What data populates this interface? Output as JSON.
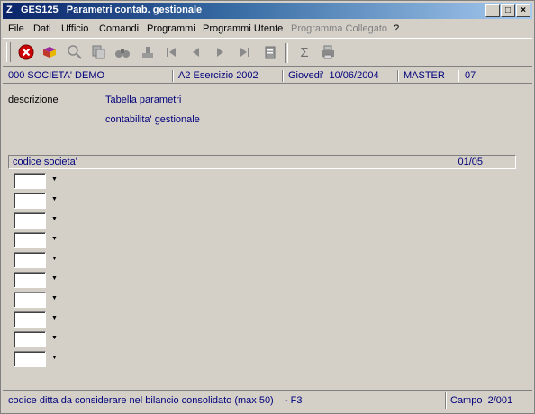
{
  "window": {
    "app_icon": "Z",
    "title": "GES125   Parametri contab. gestionale"
  },
  "window_buttons": [
    "_",
    "□",
    "×"
  ],
  "menu": [
    {
      "label": "File",
      "enabled": true
    },
    {
      "label": "Dati",
      "enabled": true
    },
    {
      "label": "Ufficio",
      "enabled": true
    },
    {
      "label": "Comandi",
      "enabled": true
    },
    {
      "label": "Programmi",
      "enabled": true
    },
    {
      "label": "Programmi Utente",
      "enabled": true
    },
    {
      "label": "Programma Collegato",
      "enabled": false
    },
    {
      "label": "?",
      "enabled": true
    }
  ],
  "toolbar": {
    "icons": [
      "exit-icon",
      "book-icon",
      "zoom-icon",
      "copy-icon",
      "binoculars-icon",
      "stamp-icon",
      "first-record-icon",
      "prev-record-icon",
      "next-record-icon",
      "last-record-icon",
      "clipboard-icon",
      "sigma-icon",
      "print-icon"
    ],
    "exit_color": "#cc0000"
  },
  "status": {
    "company": "000 SOCIETA' DEMO",
    "year": "A2 Esercizio 2002",
    "date": "Giovedi'  10/06/2004",
    "user": "MASTER",
    "code": "07"
  },
  "description": {
    "label": "descrizione",
    "line1": "Tabella parametri",
    "line2": "contabilita' gestionale"
  },
  "section": {
    "title": "codice societa'",
    "page": "01/05"
  },
  "fields": [
    {
      "value": ""
    },
    {
      "value": ""
    },
    {
      "value": ""
    },
    {
      "value": ""
    },
    {
      "value": ""
    },
    {
      "value": ""
    },
    {
      "value": ""
    },
    {
      "value": ""
    },
    {
      "value": ""
    },
    {
      "value": ""
    }
  ],
  "bottom": {
    "hint": "codice ditta da considerare nel bilancio consolidato (max 50)    - F3",
    "campo": "Campo  2/001"
  }
}
